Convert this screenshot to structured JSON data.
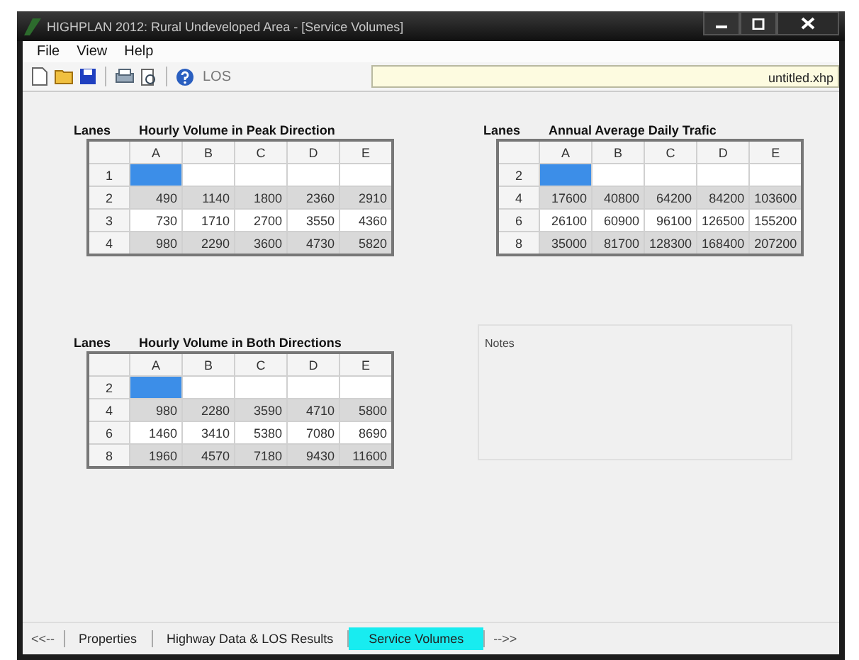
{
  "window": {
    "title": "HIGHPLAN 2012: Rural Undeveloped Area - [Service Volumes]"
  },
  "menu": [
    "File",
    "View",
    "Help"
  ],
  "toolbar": {
    "los_button": "LOS",
    "file_name": "untitled.xhp"
  },
  "tables": [
    {
      "lanes_label": "Lanes",
      "title": "Hourly Volume in Peak Direction",
      "columns": [
        "A",
        "B",
        "C",
        "D",
        "E"
      ],
      "rows": [
        {
          "lanes": "1",
          "selected": true
        },
        {
          "lanes": "2",
          "selected": false,
          "cells": [
            "490",
            "1140",
            "1800",
            "2360",
            "2910"
          ]
        },
        {
          "lanes": "3",
          "selected": false,
          "cells": [
            "730",
            "1710",
            "2700",
            "3550",
            "4360"
          ]
        },
        {
          "lanes": "4",
          "selected": false,
          "cells": [
            "980",
            "2290",
            "3600",
            "4730",
            "5820"
          ]
        }
      ]
    },
    {
      "lanes_label": "Lanes",
      "title": "Annual Average Daily Trafic",
      "columns": [
        "A",
        "B",
        "C",
        "D",
        "E"
      ],
      "rows": [
        {
          "lanes": "2",
          "selected": true
        },
        {
          "lanes": "4",
          "selected": false,
          "cells": [
            "17600",
            "40800",
            "64200",
            "84200",
            "103600"
          ]
        },
        {
          "lanes": "6",
          "selected": false,
          "cells": [
            "26100",
            "60900",
            "96100",
            "126500",
            "155200"
          ]
        },
        {
          "lanes": "8",
          "selected": false,
          "cells": [
            "35000",
            "81700",
            "128300",
            "168400",
            "207200"
          ]
        }
      ]
    },
    {
      "lanes_label": "Lanes",
      "title": "Hourly Volume in Both Directions",
      "columns": [
        "A",
        "B",
        "C",
        "D",
        "E"
      ],
      "rows": [
        {
          "lanes": "2",
          "selected": true
        },
        {
          "lanes": "4",
          "selected": false,
          "cells": [
            "980",
            "2280",
            "3590",
            "4710",
            "5800"
          ]
        },
        {
          "lanes": "6",
          "selected": false,
          "cells": [
            "1460",
            "3410",
            "5380",
            "7080",
            "8690"
          ]
        },
        {
          "lanes": "8",
          "selected": false,
          "cells": [
            "1960",
            "4570",
            "7180",
            "9430",
            "11600"
          ]
        }
      ]
    }
  ],
  "notes": {
    "label": "Notes"
  },
  "bottom_tabs": [
    {
      "kind": "arrow",
      "label": "<<--",
      "selected": false
    },
    {
      "kind": "tab",
      "label": "Properties",
      "selected": false
    },
    {
      "kind": "tab",
      "label": "Highway Data & LOS Results",
      "selected": false
    },
    {
      "kind": "tab",
      "label": "Service Volumes",
      "selected": true
    },
    {
      "kind": "arrow",
      "label": "-->>",
      "selected": false
    }
  ]
}
